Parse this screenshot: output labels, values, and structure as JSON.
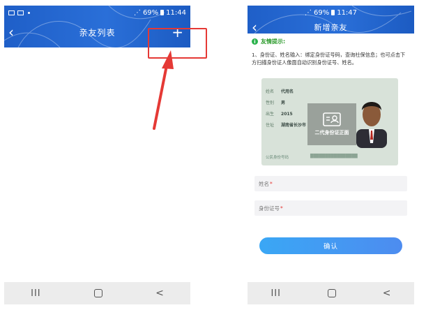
{
  "left_screen": {
    "status_time": "11:44",
    "status_battery": "69%",
    "title": "亲友列表",
    "back_icon": "chevron-left-icon",
    "add_icon": "plus-icon",
    "nav_recent": "III",
    "nav_back": "<"
  },
  "right_screen": {
    "status_time": "11:47",
    "status_battery": "69%",
    "title": "新增亲友",
    "back_icon": "chevron-left-icon",
    "tip_title": "友情提示:",
    "tip_icon": "info-icon",
    "tip_body": "1、身份证、姓名输入：绑定身份证号码，查询社保信息；也可点击下方扫描身份证人像面自动识别身份证号、姓名。",
    "id_card": {
      "label_name": "姓名",
      "name_value": "代用名",
      "label_sex": "性别",
      "sex_value": "男",
      "label_birth": "出生",
      "birth_value": "2015",
      "label_address": "住址",
      "address_value": "湖南省长沙市",
      "overlay_label": "二代身份证正面",
      "caption": "公民身份号码"
    },
    "name_field_label": "姓名",
    "id_field_label": "身份证号",
    "required_mark": "*",
    "confirm_label": "确认",
    "nav_recent": "III",
    "nav_back": "<"
  },
  "colors": {
    "appbar": "#2a6fd8",
    "highlight": "#e53935",
    "confirm": "#3aa7f5",
    "tip": "#2b9a2b"
  }
}
